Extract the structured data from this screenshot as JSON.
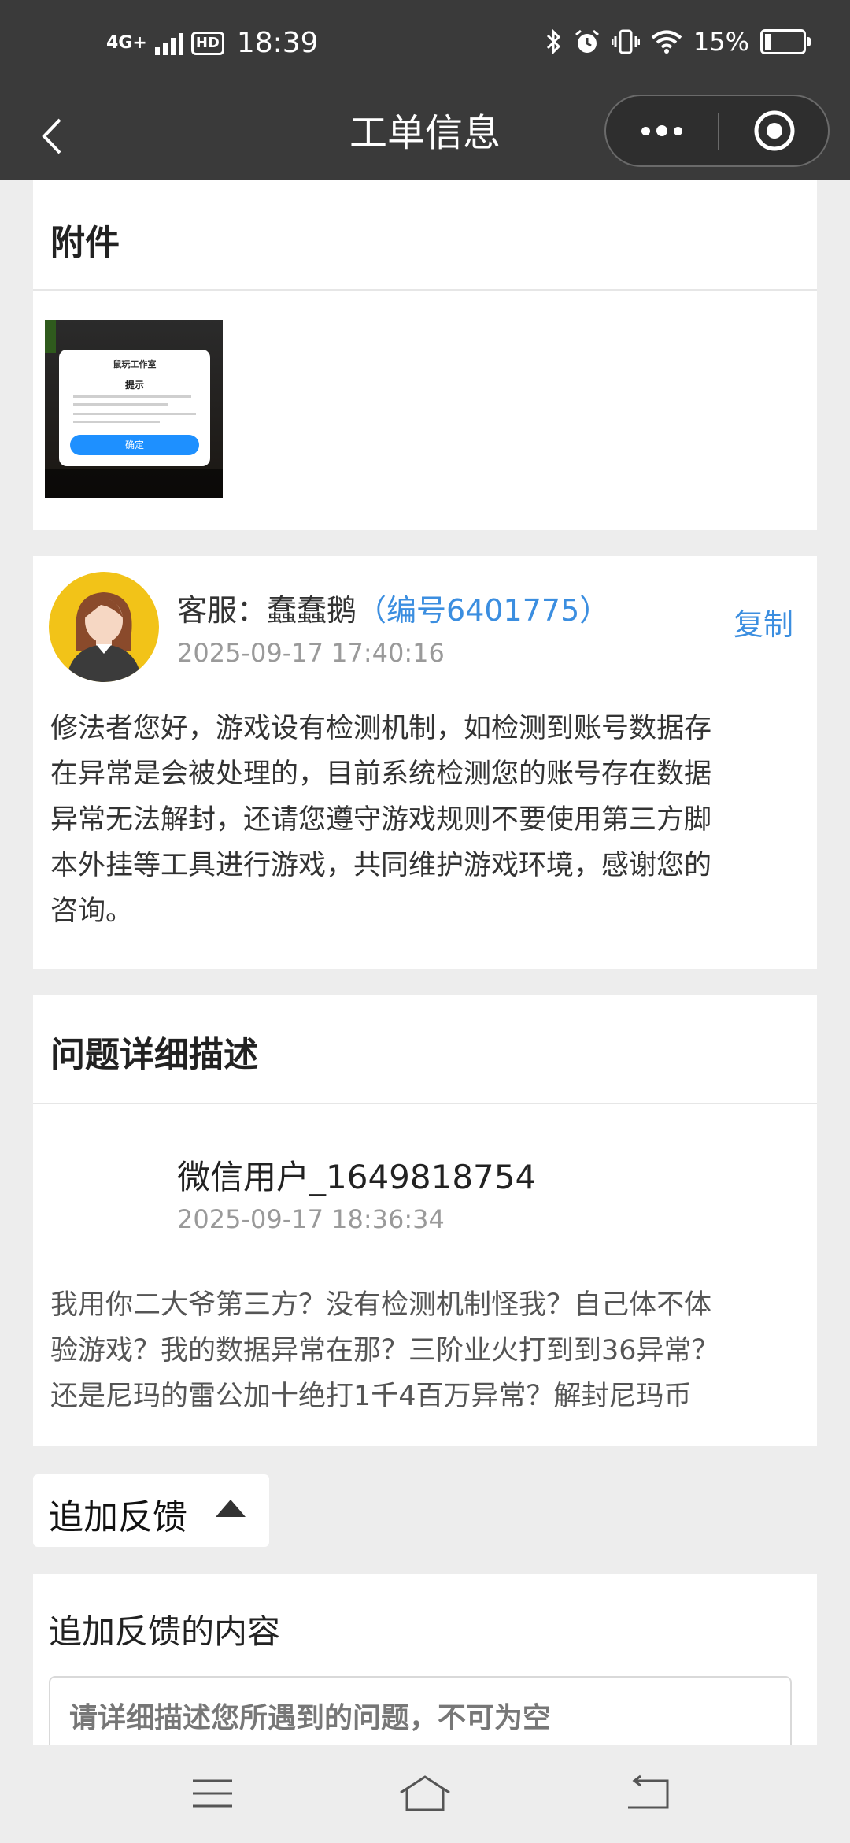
{
  "status_bar": {
    "network": "4G+",
    "hd_badge": "HD",
    "time": "18:39",
    "battery": "15%"
  },
  "nav": {
    "title": "工单信息"
  },
  "attachments": {
    "title": "附件",
    "thumbnail": {
      "brand": "鼠玩工作室",
      "dialog_title": "提示",
      "button": "确定"
    }
  },
  "agent_reply": {
    "name_prefix": "客服：蠢蠢鹅",
    "agent_id": "（编号6401775）",
    "time": "2025-09-17 17:40:16",
    "copy_label": "复制",
    "lines": [
      "修法者您好，游戏设有检测机制，如检测到账号数据存",
      "在异常是会被处理的，目前系统检测您的账号存在数据",
      "异常无法解封，还请您遵守游戏规则不要使用第三方脚",
      "本外挂等工具进行游戏，共同维护游戏环境，感谢您的",
      "咨询。"
    ]
  },
  "problem": {
    "title": "问题详细描述",
    "user": "微信用户_1649818754",
    "time": "2025-09-17 18:36:34",
    "lines": [
      "我用你二大爷第三方？没有检测机制怪我？自己体不体",
      "验游戏？我的数据异常在那？三阶业火打到到36异常？",
      "还是尼玛的雷公加十绝打1千4百万异常？解封尼玛币"
    ]
  },
  "feedback": {
    "toggle_label": "追加反馈",
    "content_label": "追加反馈的内容",
    "placeholder": "请详细描述您所遇到的问题，不可为空"
  },
  "colors": {
    "header_bg": "#3a3a3a",
    "accent_blue": "#3b8ee0",
    "page_bg": "#ededed"
  }
}
